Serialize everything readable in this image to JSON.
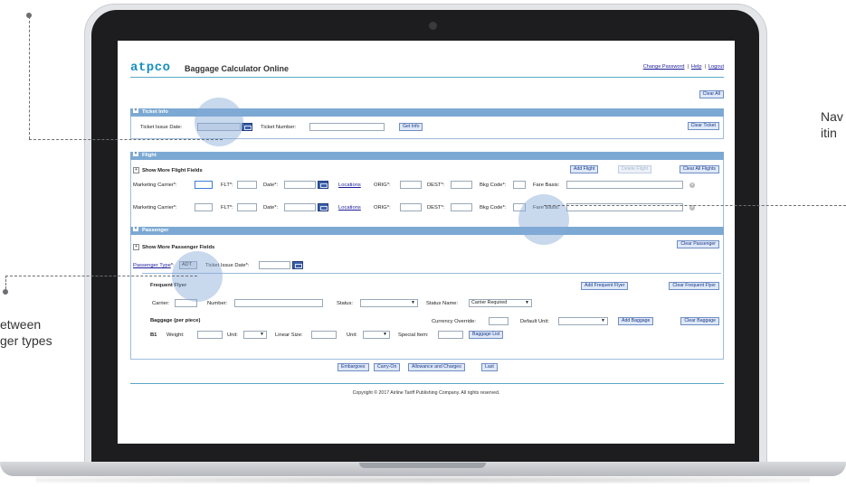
{
  "app": {
    "logo": "atpco",
    "title": "Baggage Calculator Online",
    "links": [
      "Change Password",
      "Help",
      "Logout"
    ],
    "clear_all": "Clear All"
  },
  "ticket_info": {
    "header": "Ticket Info",
    "issue_date_label": "Ticket Issue Date:",
    "issue_date_value": "",
    "number_label": "Ticket Number:",
    "get_info": "Get Info",
    "clear_ticket": "Clear Ticket"
  },
  "flight": {
    "header": "Flight",
    "more_fields": "Show More Flight Fields",
    "add_flight": "Add Flight",
    "delete_flight": "Delete Flight",
    "clear_all_flights": "Clear All Flights",
    "labels": {
      "carrier": "Marketing Carrier*:",
      "flt": "FLT*:",
      "date": "Date*:",
      "locations": "Locations",
      "orig": "ORIG*:",
      "dest": "DEST*:",
      "bkg": "Bkg Code*:",
      "fare": "Fare Basis:"
    }
  },
  "passenger": {
    "header": "Passenger",
    "more_fields": "Show More Passenger Fields",
    "clear_passenger": "Clear Passenger",
    "type_label": "Passenger Type",
    "type_suffix": "*:",
    "type_value": "ADT",
    "issue_date_label": "Ticket Issue Date*:",
    "frequent_flyer": {
      "title": "Frequent Flyer",
      "add": "Add Frequent Flyer",
      "clear": "Clear Frequent Flyer",
      "carrier_label": "Carrier:",
      "number_label": "Number:",
      "status_label": "Status:",
      "status_name_label": "Status Name:",
      "status_name_value": "Carrier Required"
    },
    "baggage": {
      "title": "Baggage (per piece)",
      "currency_label": "Currency Override:",
      "default_unit_label": "Default Unit:",
      "add": "Add Baggage",
      "clear": "Clear Baggage",
      "row_id": "B1",
      "weight_label": "Weight:",
      "unit_label": "Unit:",
      "linear_label": "Linear Size:",
      "unit2_label": "Unit:",
      "special_label": "Special Item:",
      "baggage_list": "Baggage List"
    }
  },
  "bottom_buttons": [
    "Embargoes",
    "Carry-On",
    "Allowance and Charges",
    "Last"
  ],
  "footer": "Copyright © 2017 Airline Tariff Publishing Company. All rights reserved.",
  "callouts": {
    "left_lines": [
      "etween",
      "ger types"
    ],
    "right_lines": [
      "Nav",
      "itin"
    ]
  },
  "colors": {
    "section_header": "#7ca9d3",
    "logo": "#1a8fbf",
    "halo": "#86a8d6",
    "rule": "#5aa8c8"
  }
}
